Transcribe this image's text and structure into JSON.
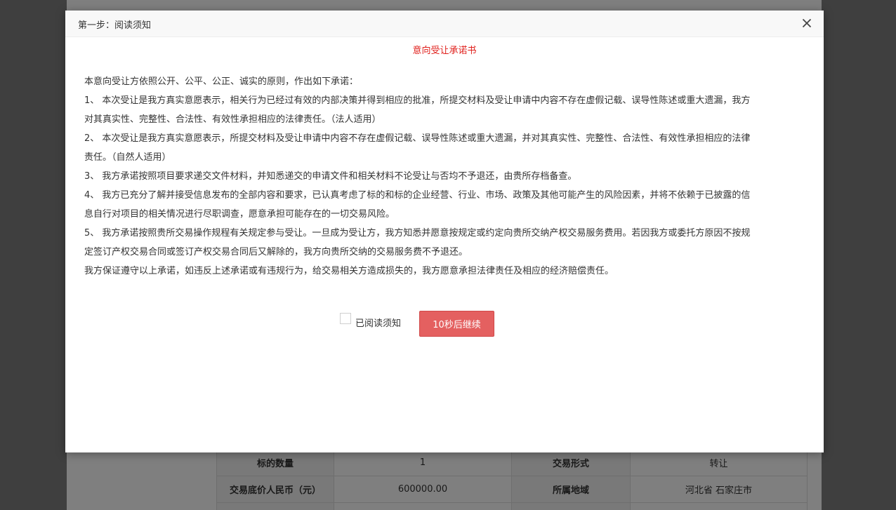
{
  "background": {
    "table": [
      [
        "标的数量",
        "1",
        "交易形式",
        "转让"
      ],
      [
        "交易底价人民币（元）",
        "600000.00",
        "所属地域",
        "河北省 石家庄市"
      ]
    ]
  },
  "modal": {
    "title": "第一步：阅读须知",
    "close_icon": "close-icon",
    "doc_title": "意向受让承诺书",
    "paragraphs": [
      "本意向受让方依照公开、公平、公正、诚实的原则，作出如下承诺：",
      "1、 本次受让是我方真实意愿表示，相关行为已经过有效的内部决策并得到相应的批准，所提交材料及受让申请中内容不存在虚假记载、误导性陈述或重大遗漏，我方对其真实性、完整性、合法性、有效性承担相应的法律责任。（法人适用）",
      "2、 本次受让是我方真实意愿表示，所提交材料及受让申请中内容不存在虚假记载、误导性陈述或重大遗漏，并对其真实性、完整性、合法性、有效性承担相应的法律责任。（自然人适用）",
      "3、 我方承诺按照项目要求递交文件材料，并知悉递交的申请文件和相关材料不论受让与否均不予退还，由贵所存档备查。",
      "4、 我方已充分了解并接受信息发布的全部内容和要求，已认真考虑了标的和标的企业经营、行业、市场、政策及其他可能产生的风险因素，并将不依赖于已披露的信息自行对项目的相关情况进行尽职调查，愿意承担可能存在的一切交易风险。",
      "5、 我方承诺按照贵所交易操作规程有关规定参与受让。一旦成为受让方，我方知悉并愿意按规定或约定向贵所交纳产权交易服务费用。若因我方或委托方原因不按规定签订产权交易合同或签订产权交易合同后又解除的，我方向贵所交纳的交易服务费不予退还。",
      "我方保证遵守以上承诺，如违反上述承诺或有违规行为，给交易相关方造成损失的，我方愿意承担法律责任及相应的经济赔偿责任。"
    ],
    "checkbox_label": "已阅读须知",
    "continue_button": "10秒后继续",
    "colors": {
      "doc_title": "#e0201c",
      "button": "#e46060"
    }
  }
}
